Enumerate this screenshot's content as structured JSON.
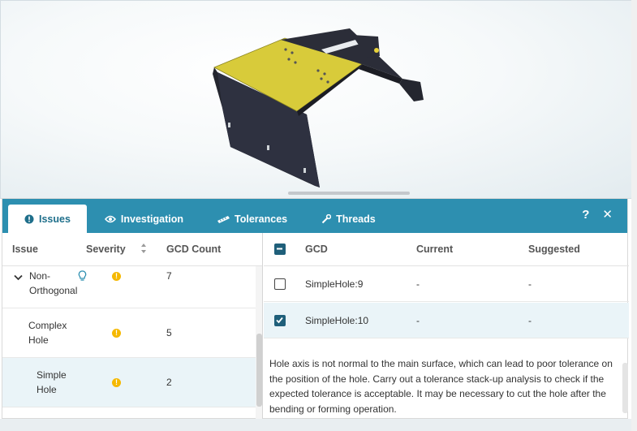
{
  "tabs": [
    {
      "label": "Issues",
      "icon": "exclamation-circle-icon",
      "active": true
    },
    {
      "label": "Investigation",
      "icon": "eye-icon",
      "active": false
    },
    {
      "label": "Tolerances",
      "icon": "ruler-icon",
      "active": false
    },
    {
      "label": "Threads",
      "icon": "wrench-icon",
      "active": false
    }
  ],
  "actions": {
    "help": "?",
    "close": "✕"
  },
  "issues_table": {
    "headers": {
      "issue": "Issue",
      "severity": "Severity",
      "gcd_count": "GCD Count"
    },
    "rows": [
      {
        "line1": "Non-",
        "line2": "Orthogonal",
        "count": "7",
        "expanded": true,
        "hint_icon": "lightbulb-icon"
      },
      {
        "line1": "Complex",
        "line2": "Hole",
        "count": "5"
      },
      {
        "line1": "Simple",
        "line2": "Hole",
        "count": "2",
        "selected": true
      }
    ]
  },
  "gcd_table": {
    "headers": {
      "gcd": "GCD",
      "current": "Current",
      "suggested": "Suggested"
    },
    "rows": [
      {
        "gcd": "SimpleHole:9",
        "current": "-",
        "suggested": "-",
        "checked": false
      },
      {
        "gcd": "SimpleHole:10",
        "current": "-",
        "suggested": "-",
        "checked": true
      }
    ]
  },
  "description": "Hole axis is not normal to the main surface, which can lead to poor tolerance on the position of the hole. Carry out a tolerance stack-up analysis to check if the expected tolerance is acceptable. It may be necessary to cut the hole after the bending or forming operation.",
  "colors": {
    "accent": "#2d8fb0",
    "highlight": "#d8cb3a",
    "severity": "#f5b800",
    "part": "#2b2d38"
  }
}
